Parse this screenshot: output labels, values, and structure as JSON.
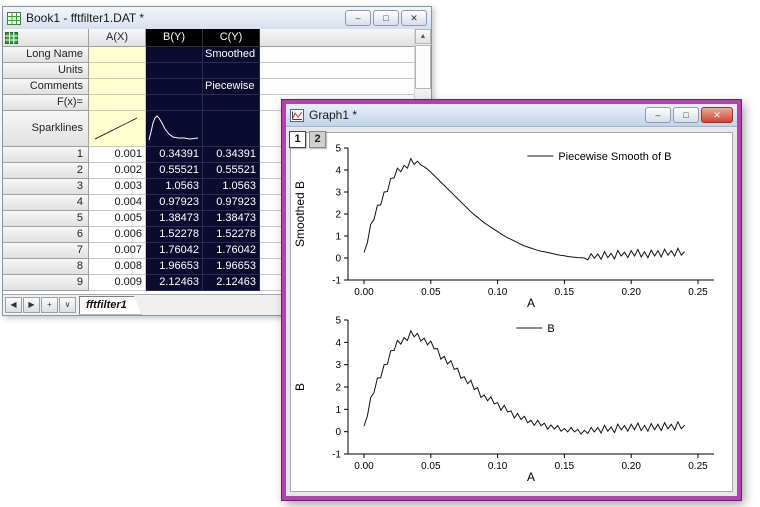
{
  "book_window": {
    "title": "Book1 - fftfilter1.DAT *",
    "columns": [
      "A(X)",
      "B(Y)",
      "C(Y)"
    ],
    "label_rows": [
      {
        "label": "Long Name",
        "a": "",
        "b": "",
        "c": "Smoothed"
      },
      {
        "label": "Units",
        "a": "",
        "b": "",
        "c": ""
      },
      {
        "label": "Comments",
        "a": "",
        "b": "",
        "c": "Piecewise"
      },
      {
        "label": "F(x)=",
        "a": "",
        "b": "",
        "c": ""
      }
    ],
    "sparklines_label": "Sparklines",
    "data_rows": [
      {
        "n": "1",
        "a": "0.001",
        "b": "0.34391",
        "c": "0.34391"
      },
      {
        "n": "2",
        "a": "0.002",
        "b": "0.55521",
        "c": "0.55521"
      },
      {
        "n": "3",
        "a": "0.003",
        "b": "1.0563",
        "c": "1.0563"
      },
      {
        "n": "4",
        "a": "0.004",
        "b": "0.97923",
        "c": "0.97923"
      },
      {
        "n": "5",
        "a": "0.005",
        "b": "1.38473",
        "c": "1.38473"
      },
      {
        "n": "6",
        "a": "0.006",
        "b": "1.52278",
        "c": "1.52278"
      },
      {
        "n": "7",
        "a": "0.007",
        "b": "1.76042",
        "c": "1.76042"
      },
      {
        "n": "8",
        "a": "0.008",
        "b": "1.96653",
        "c": "1.96653"
      },
      {
        "n": "9",
        "a": "0.009",
        "b": "2.12463",
        "c": "2.12463"
      }
    ],
    "sheet_tab": "fftfilter1",
    "nav_buttons": [
      "◀",
      "▶",
      "+",
      "∨"
    ]
  },
  "graph_window": {
    "title": "Graph1 *",
    "layer_buttons": [
      "1",
      "2"
    ]
  },
  "window_controls": {
    "minimize": "–",
    "maximize": "□",
    "close": "✕"
  },
  "scrollbar": {
    "up": "▲",
    "down": "▼"
  },
  "chart_data": [
    {
      "type": "line",
      "title": "",
      "xlabel": "A",
      "ylabel": "Smoothed B",
      "legend": "Piecewise Smooth of B",
      "legend_position": "top-right-inside",
      "grid": false,
      "xlim": [
        -0.012,
        0.262
      ],
      "ylim": [
        -1,
        5
      ],
      "xticks": [
        0,
        0.05,
        0.1,
        0.15,
        0.2,
        0.25
      ],
      "yticks": [
        -1,
        0,
        1,
        2,
        3,
        4,
        5
      ],
      "legend_anchor": [
        0.49,
        0.06
      ],
      "x_start": 0,
      "x_step": 0.0025,
      "values": [
        0.25,
        0.7,
        1.53,
        1.75,
        2.4,
        2.41,
        3.0,
        3.02,
        3.62,
        3.64,
        4.08,
        3.92,
        4.21,
        4.08,
        4.52,
        4.25,
        4.4,
        4.23,
        4.15,
        4.03,
        3.9,
        3.75,
        3.6,
        3.45,
        3.3,
        3.15,
        3.0,
        2.85,
        2.7,
        2.55,
        2.4,
        2.25,
        2.1,
        1.97,
        1.85,
        1.72,
        1.6,
        1.5,
        1.4,
        1.3,
        1.2,
        1.1,
        1.0,
        0.92,
        0.85,
        0.77,
        0.7,
        0.62,
        0.55,
        0.5,
        0.45,
        0.4,
        0.35,
        0.31,
        0.28,
        0.25,
        0.22,
        0.18,
        0.15,
        0.12,
        0.1,
        0.07,
        0.05,
        0.03,
        0.02,
        0.01,
        0.0,
        -0.08,
        0.19,
        -0.01,
        0.18,
        -0.06,
        0.29,
        0.02,
        0.21,
        -0.04,
        0.34,
        0.09,
        0.27,
        0.02,
        0.33,
        0.09,
        0.39,
        0.05,
        0.28,
        0.02,
        0.36,
        0.09,
        0.33,
        0.05,
        0.4,
        0.13,
        0.33,
        0.08,
        0.44,
        0.13,
        0.29
      ]
    },
    {
      "type": "line",
      "title": "",
      "xlabel": "A",
      "ylabel": "B",
      "legend": "B",
      "legend_position": "top-center-inside",
      "grid": false,
      "xlim": [
        -0.012,
        0.262
      ],
      "ylim": [
        -1,
        5
      ],
      "xticks": [
        0,
        0.05,
        0.1,
        0.15,
        0.2,
        0.25
      ],
      "yticks": [
        -1,
        0,
        1,
        2,
        3,
        4,
        5
      ],
      "legend_anchor": [
        0.46,
        0.06
      ],
      "x_start": 0,
      "x_step": 0.0025,
      "values": [
        0.25,
        0.7,
        1.53,
        1.75,
        2.4,
        2.41,
        3.0,
        3.02,
        3.62,
        3.64,
        4.08,
        3.92,
        4.21,
        4.08,
        4.52,
        4.25,
        4.4,
        4.05,
        4.19,
        3.89,
        4.06,
        3.71,
        3.72,
        3.25,
        3.38,
        3.03,
        3.18,
        2.79,
        2.84,
        2.39,
        2.46,
        2.15,
        2.3,
        1.89,
        1.97,
        1.54,
        1.64,
        1.38,
        1.56,
        1.24,
        1.3,
        0.96,
        1.18,
        0.88,
        0.93,
        0.61,
        0.82,
        0.54,
        0.69,
        0.4,
        0.51,
        0.28,
        0.51,
        0.27,
        0.38,
        0.11,
        0.3,
        0.12,
        0.27,
        0.02,
        0.14,
        -0.01,
        0.19,
        -0.01,
        0.1,
        -0.11,
        0.06,
        -0.08,
        0.19,
        -0.01,
        0.18,
        -0.06,
        0.29,
        0.02,
        0.21,
        -0.04,
        0.34,
        0.09,
        0.27,
        0.02,
        0.33,
        0.09,
        0.39,
        0.05,
        0.28,
        0.02,
        0.36,
        0.09,
        0.33,
        0.05,
        0.4,
        0.13,
        0.33,
        0.08,
        0.44,
        0.13,
        0.29
      ]
    }
  ]
}
